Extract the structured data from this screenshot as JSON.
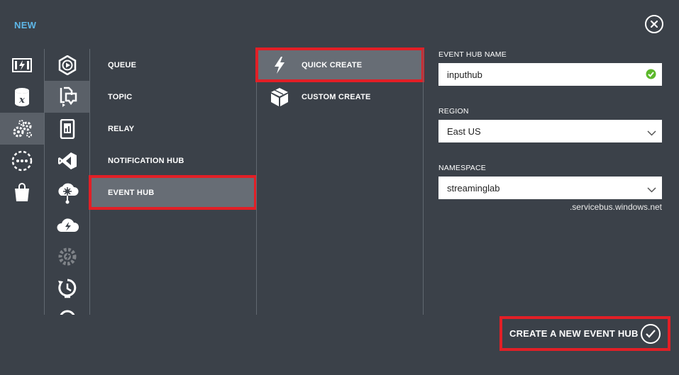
{
  "header": {
    "title": "NEW"
  },
  "nav_icons": {
    "primary": [
      "compute-services-icon",
      "data-services-icon",
      "app-services-icon",
      "network-services-icon",
      "store-icon"
    ],
    "secondary": [
      "media-services-icon",
      "service-bus-icon",
      "mobile-services-icon",
      "visual-studio-online-icon",
      "biztalk-services-icon",
      "cloud-services-icon",
      "scheduler-icon",
      "backup-icon"
    ]
  },
  "service_bus_menu": {
    "items": [
      {
        "label": "QUEUE"
      },
      {
        "label": "TOPIC"
      },
      {
        "label": "RELAY"
      },
      {
        "label": "NOTIFICATION HUB"
      },
      {
        "label": "EVENT HUB"
      }
    ],
    "selected": "EVENT HUB"
  },
  "create_options": {
    "items": [
      {
        "label": "QUICK CREATE",
        "icon": "lightning-icon"
      },
      {
        "label": "CUSTOM CREATE",
        "icon": "box-icon"
      }
    ],
    "selected": "QUICK CREATE"
  },
  "form": {
    "event_hub_name": {
      "label": "EVENT HUB NAME",
      "value": "inputhub"
    },
    "region": {
      "label": "REGION",
      "value": "East US"
    },
    "namespace": {
      "label": "NAMESPACE",
      "value": "streaminglab",
      "suffix": ".servicebus.windows.net"
    }
  },
  "footer": {
    "create_label": "CREATE A NEW EVENT HUB"
  },
  "colors": {
    "background": "#3b4149",
    "selected_tile": "#5a6068",
    "selected_item": "#676d75",
    "highlight_border": "#e21f26",
    "title_accent": "#5eb7e8",
    "valid_check": "#5cb82b"
  }
}
